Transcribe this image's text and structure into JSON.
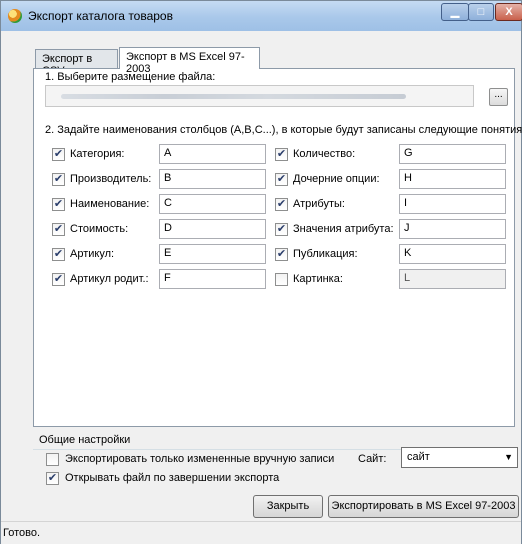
{
  "window": {
    "title": "Экспорт каталога товаров"
  },
  "tabs": [
    "Экспорт в CSV",
    "Экспорт в MS Excel 97-2003"
  ],
  "file": {
    "step1_label": "1. Выберите размещение файла:",
    "browse_label": "..."
  },
  "columns": {
    "step2_label": "2. Задайте наименования столбцов (A,B,C...), в которые будут записаны следующие понятия:",
    "left": [
      {
        "label": "Категория:",
        "value": "A",
        "checked": true
      },
      {
        "label": "Производитель:",
        "value": "B",
        "checked": true
      },
      {
        "label": "Наименование:",
        "value": "C",
        "checked": true
      },
      {
        "label": "Стоимость:",
        "value": "D",
        "checked": true
      },
      {
        "label": "Артикул:",
        "value": "E",
        "checked": true
      },
      {
        "label": "Артикул родит.:",
        "value": "F",
        "checked": true
      }
    ],
    "right": [
      {
        "label": "Количество:",
        "value": "G",
        "checked": true
      },
      {
        "label": "Дочерние опции:",
        "value": "H",
        "checked": true
      },
      {
        "label": "Атрибуты:",
        "value": "I",
        "checked": true
      },
      {
        "label": "Значения атрибута:",
        "value": "J",
        "checked": true
      },
      {
        "label": "Публикация:",
        "value": "K",
        "checked": true
      },
      {
        "label": "Картинка:",
        "value": "L",
        "checked": false
      }
    ]
  },
  "general": {
    "title": "Общие настройки",
    "export_modified_label": "Экспортировать только измененные вручную записи",
    "export_modified_checked": false,
    "open_after_label": "Открывать файл по завершении экспорта",
    "open_after_checked": true,
    "site_label": "Сайт:",
    "site_value": "сайт"
  },
  "buttons": {
    "close": "Закрыть",
    "export": "Экспортировать в MS Excel 97-2003"
  },
  "status": "Готово."
}
